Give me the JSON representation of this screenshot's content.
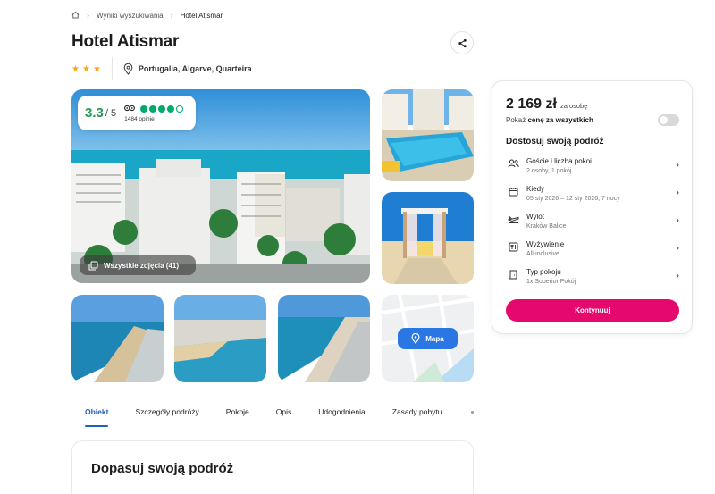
{
  "breadcrumb": {
    "items": [
      "Wyniki wyszukiwania",
      "Hotel Atismar"
    ]
  },
  "hotel": {
    "name": "Hotel Atismar",
    "stars": 3,
    "location": "Portugalia, Algarve, Quarteira"
  },
  "rating": {
    "score": "3.3",
    "scale": "/ 5",
    "bubbles_filled": 4,
    "bubbles_total": 5,
    "opinions": "1484 opinie"
  },
  "gallery": {
    "all_photos_label": "Wszystkie zdjęcia (41)",
    "map_label": "Mapa"
  },
  "tabs": [
    "Obiekt",
    "Szczegóły podróży",
    "Pokoje",
    "Opis",
    "Udogodnienia",
    "Zasady pobytu"
  ],
  "active_tab": "Obiekt",
  "section": {
    "title": "Dopasuj swoją podróż"
  },
  "sidebar": {
    "price": "2 169 zł",
    "price_per": "za osobę",
    "show_all_prefix": "Pokaż",
    "show_all_bold": "cenę za wszystkich",
    "toggle_on": false,
    "title": "Dostosuj swoją podróż",
    "options": [
      {
        "icon": "guests-icon",
        "label": "Goście i liczba pokoi",
        "value": "2 osoby, 1 pokój"
      },
      {
        "icon": "calendar-icon",
        "label": "Kiedy",
        "value": "05 sty 2026 – 12 sty 2026, 7 nocy"
      },
      {
        "icon": "plane-icon",
        "label": "Wylot",
        "value": "Kraków Balice"
      },
      {
        "icon": "food-icon",
        "label": "Wyżywienie",
        "value": "All-inclusive"
      },
      {
        "icon": "door-icon",
        "label": "Typ pokoju",
        "value": "1x Superior Pokój"
      }
    ],
    "cta": "Kontynuuj"
  },
  "colors": {
    "accent_pink": "#e6096d",
    "link_blue": "#1f5fbf",
    "rating_green": "#00aa6c",
    "star": "#f5a623",
    "map_button": "#2a77e4"
  }
}
